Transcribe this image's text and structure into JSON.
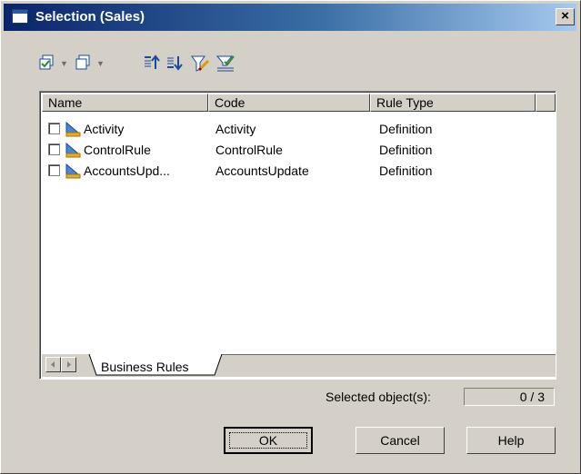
{
  "window": {
    "title": "Selection (Sales)",
    "close_glyph": "×"
  },
  "toolbar": {
    "buttons": [
      {
        "name": "select-all-icon",
        "has_menu": true
      },
      {
        "name": "deselect-all-icon",
        "has_menu": true
      },
      {
        "name": "move-to-top-icon",
        "has_menu": false
      },
      {
        "name": "move-to-bottom-icon",
        "has_menu": false
      },
      {
        "name": "filter-icon",
        "has_menu": false
      },
      {
        "name": "filter-selected-icon",
        "has_menu": false
      }
    ],
    "dropdown_glyph": "▼"
  },
  "list": {
    "columns": [
      "Name",
      "Code",
      "Rule Type"
    ],
    "rows": [
      {
        "name": "Activity",
        "code": "Activity",
        "rule_type": "Definition"
      },
      {
        "name": "ControlRule",
        "code": "ControlRule",
        "rule_type": "Definition"
      },
      {
        "name": "AccountsUpd...",
        "code": "AccountsUpdate",
        "rule_type": "Definition"
      }
    ],
    "tab_label": "Business Rules"
  },
  "status": {
    "label": "Selected object(s):",
    "value": "0 / 3"
  },
  "buttons": {
    "ok": "OK",
    "cancel": "Cancel",
    "help": "Help"
  },
  "colors": {
    "titlebar_start": "#0a246a",
    "titlebar_end": "#a6caf0",
    "dialog_face": "#d4d0c8"
  }
}
